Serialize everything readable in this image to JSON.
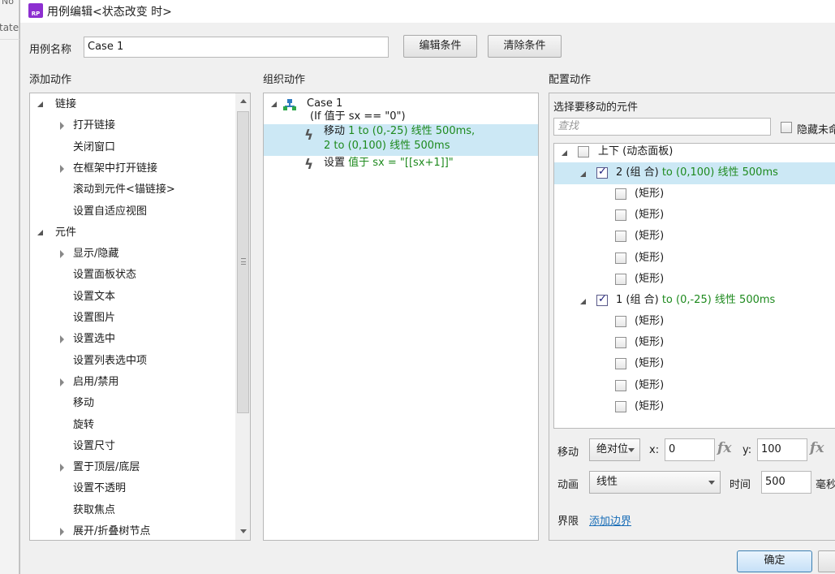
{
  "background": {
    "top_text": "No",
    "side_text": "tate"
  },
  "window": {
    "title": "用例编辑<状态改变 时>",
    "icon_text": "RP"
  },
  "case_name": {
    "label": "用例名称",
    "value": "Case 1"
  },
  "buttons": {
    "edit_condition": "编辑条件",
    "clear_condition": "清除条件",
    "ok": "确定"
  },
  "add_actions": {
    "header": "添加动作",
    "items": [
      {
        "label": "链接",
        "level": 0,
        "toggle": "expanded"
      },
      {
        "label": "打开链接",
        "level": 1,
        "toggle": "collapsed"
      },
      {
        "label": "关闭窗口",
        "level": 1,
        "toggle": "none"
      },
      {
        "label": "在框架中打开链接",
        "level": 1,
        "toggle": "collapsed"
      },
      {
        "label": "滚动到元件<锚链接>",
        "level": 1,
        "toggle": "none"
      },
      {
        "label": "设置自适应视图",
        "level": 1,
        "toggle": "none"
      },
      {
        "label": "元件",
        "level": 0,
        "toggle": "expanded"
      },
      {
        "label": "显示/隐藏",
        "level": 1,
        "toggle": "collapsed"
      },
      {
        "label": "设置面板状态",
        "level": 1,
        "toggle": "none"
      },
      {
        "label": "设置文本",
        "level": 1,
        "toggle": "none"
      },
      {
        "label": "设置图片",
        "level": 1,
        "toggle": "none"
      },
      {
        "label": "设置选中",
        "level": 1,
        "toggle": "collapsed"
      },
      {
        "label": "设置列表选中项",
        "level": 1,
        "toggle": "none"
      },
      {
        "label": "启用/禁用",
        "level": 1,
        "toggle": "collapsed"
      },
      {
        "label": "移动",
        "level": 1,
        "toggle": "none"
      },
      {
        "label": "旋转",
        "level": 1,
        "toggle": "none"
      },
      {
        "label": "设置尺寸",
        "level": 1,
        "toggle": "none"
      },
      {
        "label": "置于顶层/底层",
        "level": 1,
        "toggle": "collapsed"
      },
      {
        "label": "设置不透明",
        "level": 1,
        "toggle": "none"
      },
      {
        "label": "获取焦点",
        "level": 1,
        "toggle": "none"
      },
      {
        "label": "展开/折叠树节点",
        "level": 1,
        "toggle": "collapsed"
      }
    ]
  },
  "organize_actions": {
    "header": "组织动作",
    "case_label": "Case 1",
    "case_condition": "(If 值于 sx == \"0\")",
    "actions": [
      {
        "verb": "移动",
        "line1": "1 to (0,-25) 线性 500ms,",
        "line2": "2 to (0,100) 线性 500ms",
        "selected": true
      },
      {
        "verb": "设置",
        "line1": "值于 sx = \"[[sx+1]]\"",
        "line2": "",
        "selected": false
      }
    ]
  },
  "configure_actions": {
    "header": "配置动作",
    "subheader": "选择要移动的元件",
    "search_placeholder": "查找",
    "hide_unnamed_label": "隐藏未命",
    "tree": {
      "root": {
        "label": "上下 (动态面板)"
      },
      "group2": {
        "name": "2 (组 合)",
        "detail": "to (0,100) 线性 500ms"
      },
      "group2_children": [
        "(矩形)",
        "(矩形)",
        "(矩形)",
        "(矩形)",
        "(矩形)"
      ],
      "group1": {
        "name": "1 (组 合)",
        "detail": "to (0,-25) 线性 500ms"
      },
      "group1_children": [
        "(矩形)",
        "(矩形)",
        "(矩形)",
        "(矩形)",
        "(矩形)"
      ]
    },
    "move": {
      "label": "移动",
      "mode": "绝对位",
      "x_label": "x:",
      "x_value": "0",
      "y_label": "y:",
      "y_value": "100",
      "fx": "fx"
    },
    "animation": {
      "label": "动画",
      "value": "线性",
      "time_label": "时间",
      "time_value": "500",
      "unit": "毫秒"
    },
    "bounds": {
      "label": "界限",
      "link": "添加边界"
    }
  }
}
